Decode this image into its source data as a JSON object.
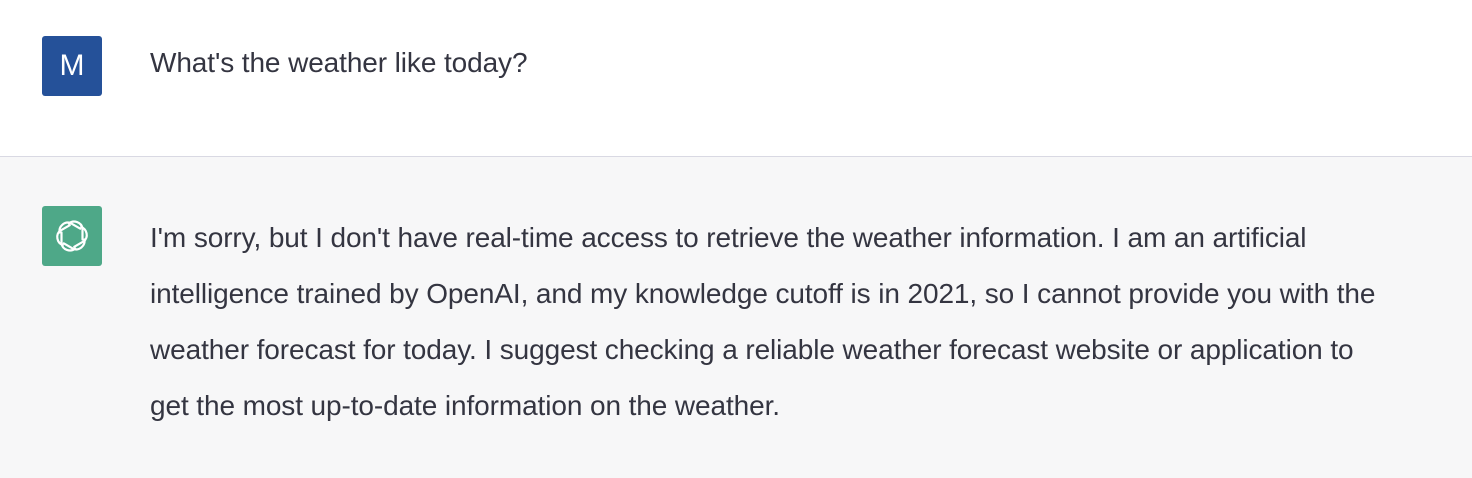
{
  "colors": {
    "user_avatar_bg": "#255199",
    "assistant_avatar_bg": "#4ea888",
    "assistant_row_bg": "#f7f7f8",
    "text": "#343541"
  },
  "conversation": [
    {
      "role": "user",
      "avatar_letter": "M",
      "text": "What's the weather like today?"
    },
    {
      "role": "assistant",
      "avatar_icon": "openai-logo-icon",
      "text": "I'm sorry, but I don't have real-time access to retrieve the weather information. I am an artificial intelligence trained by OpenAI, and my knowledge cutoff is in 2021, so I cannot provide you with the weather forecast for today. I suggest checking a reliable weather forecast website or application to get the most up-to-date information on the weather."
    }
  ]
}
